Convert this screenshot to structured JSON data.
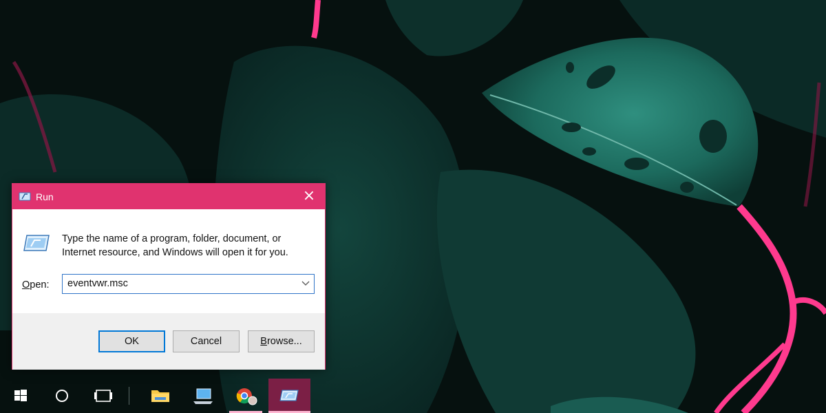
{
  "dialog": {
    "title": "Run",
    "close_glyph": "×",
    "description": "Type the name of a program, folder, document, or Internet resource, and Windows will open it for you.",
    "open_label_underlined": "O",
    "open_label_rest": "pen:",
    "open_value": "eventvwr.msc",
    "ok_label": "OK",
    "cancel_label": "Cancel",
    "browse_label_underlined": "B",
    "browse_label_rest": "rowse..."
  },
  "taskbar": {
    "items": [
      {
        "name": "start-button",
        "icon": "windows-logo-icon"
      },
      {
        "name": "cortana-button",
        "icon": "circle-icon"
      },
      {
        "name": "task-view-button",
        "icon": "task-view-icon"
      },
      {
        "name": "file-explorer-button",
        "icon": "folder-icon"
      },
      {
        "name": "this-pc-button",
        "icon": "computer-icon"
      },
      {
        "name": "chrome-button",
        "icon": "chrome-icon"
      },
      {
        "name": "run-taskbar-button",
        "icon": "run-icon"
      }
    ]
  },
  "colors": {
    "accent": "#e0336f",
    "focus_blue": "#2e73c7",
    "desktop_dark": "#06110f",
    "leaf_teal": "#1f6a5e",
    "stem_pink": "#ff3a8e"
  }
}
